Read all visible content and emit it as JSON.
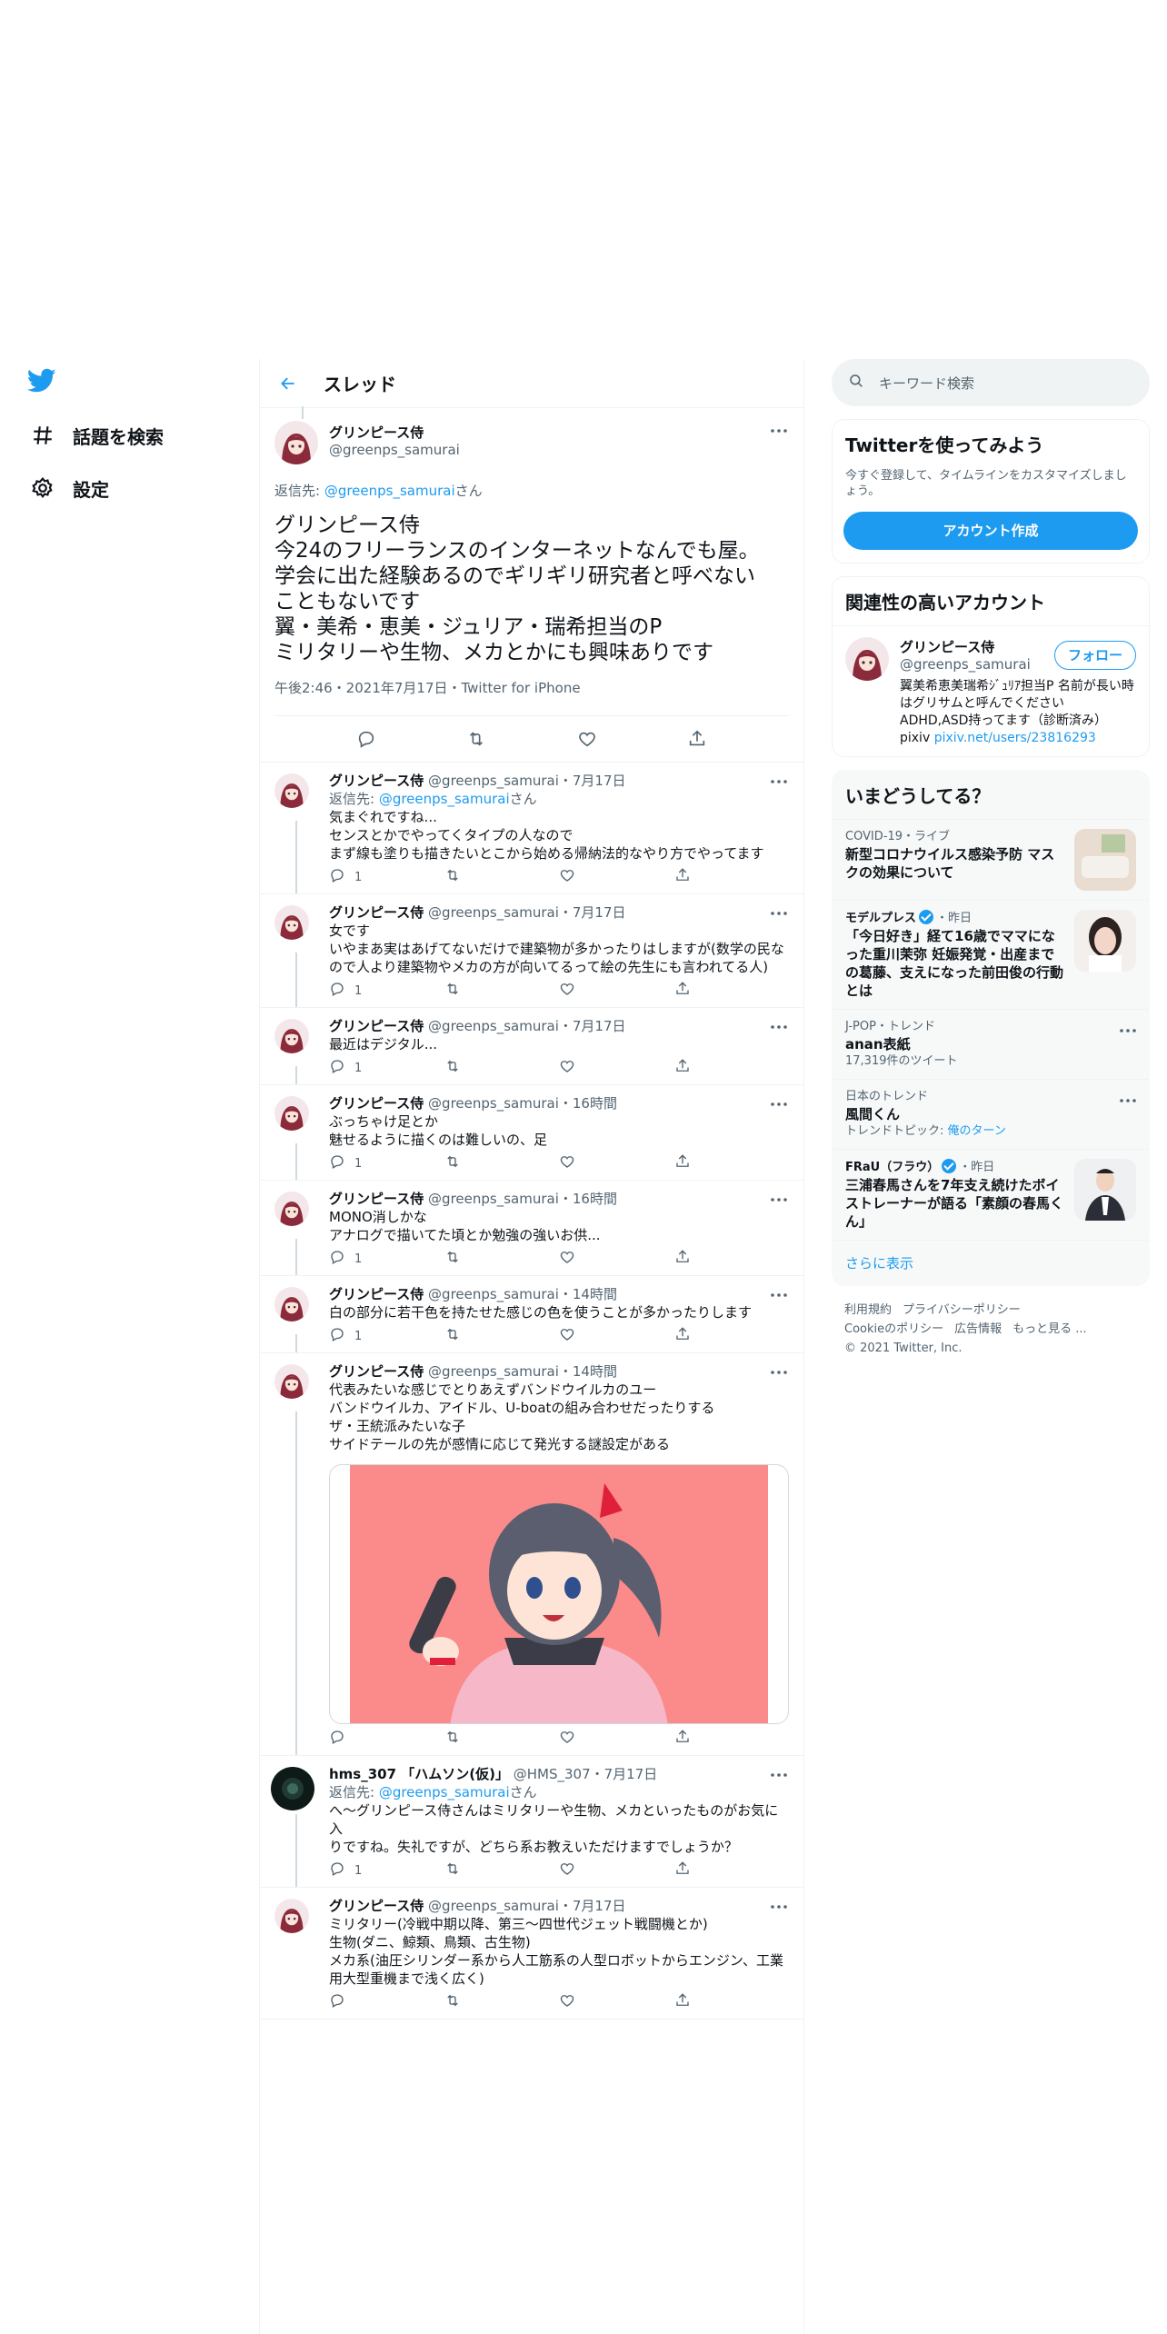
{
  "nav": {
    "explore_label": "話題を検索",
    "settings_label": "設定"
  },
  "header": {
    "title": "スレッド"
  },
  "main_tweet": {
    "name": "グリンピース侍",
    "handle": "@greenps_samurai",
    "reply_prefix": "返信先: ",
    "reply_handle": "@greenps_samurai",
    "reply_suffix": "さん",
    "text": "グリンピース侍\n今24のフリーランスのインターネットなんでも屋。\n学会に出た経験あるのでギリギリ研究者と呼べない\nこともないです\n翼・美希・恵美・ジュリア・瑞希担当のP\nミリタリーや生物、メカとかにも興味ありです",
    "meta": "午後2:46・2021年7月17日・Twitter for iPhone"
  },
  "replies": [
    {
      "name": "グリンピース侍",
      "handle": "@greenps_samurai",
      "time": "・7月17日",
      "reply_prefix": "返信先: ",
      "reply_handle": "@greenps_samurai",
      "reply_suffix": "さん",
      "text": "気まぐれですね...\nセンスとかでやってくタイプの人なので\nまず線も塗りも描きたいとこから始める帰納法的なやり方でやってます",
      "replies": "1"
    },
    {
      "name": "グリンピース侍",
      "handle": "@greenps_samurai",
      "time": "・7月17日",
      "text": "女です\nいやまあ実はあげてないだけで建築物が多かったりはしますが(数学の民な\nので人より建築物やメカの方が向いてるって絵の先生にも言われてる人)",
      "replies": "1"
    },
    {
      "name": "グリンピース侍",
      "handle": "@greenps_samurai",
      "time": "・7月17日",
      "text": "最近はデジタル...",
      "replies": "1"
    },
    {
      "name": "グリンピース侍",
      "handle": "@greenps_samurai",
      "time": "・16時間",
      "text": "ぶっちゃけ足とか\n魅せるように描くのは難しいの、足",
      "replies": "1"
    },
    {
      "name": "グリンピース侍",
      "handle": "@greenps_samurai",
      "time": "・16時間",
      "text": "MONO消しかな\nアナログで描いてた頃とか勉強の強いお供...",
      "replies": "1"
    },
    {
      "name": "グリンピース侍",
      "handle": "@greenps_samurai",
      "time": "・14時間",
      "text": "白の部分に若干色を持たせた感じの色を使うことが多かったりします",
      "replies": "1"
    },
    {
      "name": "グリンピース侍",
      "handle": "@greenps_samurai",
      "time": "・14時間",
      "text": "代表みたいな感じでとりあえずバンドウイルカのユー\nバンドウイルカ、アイドル、U-boatの組み合わせだったりする\nザ・王統派みたいな子\nサイドテールの先が感情に応じて発光する謎設定がある",
      "replies": ""
    },
    {
      "name": "hms_307 「ハムソン(仮)」",
      "handle": "@HMS_307",
      "time": "・7月17日",
      "reply_prefix": "返信先: ",
      "reply_handle": "@greenps_samurai",
      "reply_suffix": "さん",
      "text": "へ～グリンピース侍さんはミリタリーや生物、メカといったものがお気に入\nりですね。失礼ですが、どちら系お教えいただけますでしょうか？",
      "replies": "1"
    },
    {
      "name": "グリンピース侍",
      "handle": "@greenps_samurai",
      "time": "・7月17日",
      "text": "ミリタリー(冷戦中期以降、第三〜四世代ジェット戦闘機とか)\n生物(ダニ、鯨類、鳥類、古生物)\nメカ系(油圧シリンダー系から人工筋系の人型ロボットからエンジン、工業\n用大型重機まで浅く広く)",
      "replies": ""
    }
  ],
  "search": {
    "placeholder": "キーワード検索"
  },
  "signup": {
    "title": "Twitterを使ってみよう",
    "desc": "今すぐ登録して、タイムラインをカスタマイズしましょう。",
    "button": "アカウント作成"
  },
  "related": {
    "title": "関連性の高いアカウント",
    "name": "グリンピース侍",
    "handle": "@greenps_samurai",
    "follow": "フォロー",
    "bio": "翼美希恵美瑞希ｼﾞｭﾘｱ担当P 名前が長い時はグリサムと呼んでください\nADHD,ASD持ってます（診断済み）\npixiv ",
    "link": "pixiv.net/users/23816293"
  },
  "trends": {
    "title": "いまどうしてる？",
    "items": [
      {
        "cat": "COVID-19・ライブ",
        "title": "新型コロナウイルス感染予防 マスクの効果について"
      },
      {
        "source": "モデルプレス",
        "cat": "・昨日",
        "title": "「今日好き」経て16歳でママになった重川茉弥 妊娠発覚・出産までの葛藤、支えになった前田俊の行動とは"
      },
      {
        "cat": "J-POP・トレンド",
        "title": "anan表紙",
        "sub": "17,319件のツイート"
      },
      {
        "cat": "日本のトレンド",
        "title": "風間くん",
        "sub_prefix": "トレンドトピック: ",
        "sub_link": "俺のターン"
      },
      {
        "source": "FRaU（フラウ）",
        "cat": "・昨日",
        "title": "三浦春馬さんを7年支え続けたボイストレーナーが語る「素顔の春馬くん」"
      }
    ],
    "showmore": "さらに表示"
  },
  "footer": {
    "terms": "利用規約",
    "privacy": "プライバシーポリシー",
    "cookie": "Cookieのポリシー",
    "ads": "広告情報",
    "more": "もっと見る ...",
    "copyright": "© 2021 Twitter, Inc."
  }
}
